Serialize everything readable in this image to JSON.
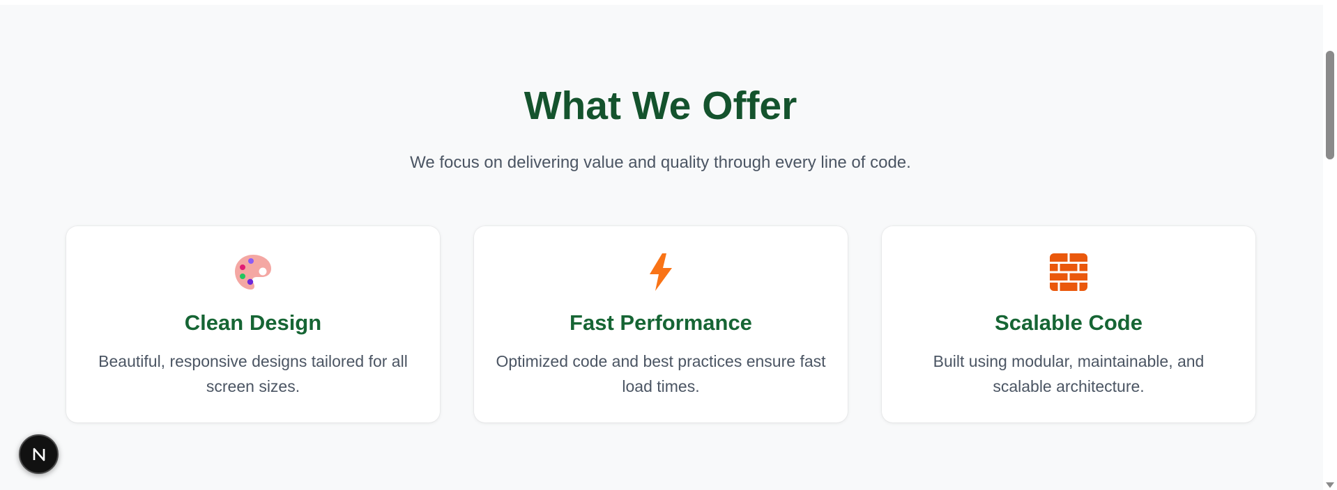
{
  "section": {
    "title": "What We Offer",
    "subtitle": "We focus on delivering value and quality through every line of code."
  },
  "cards": [
    {
      "icon": "palette-icon",
      "title": "Clean Design",
      "description": "Beautiful, responsive designs tailored for all screen sizes."
    },
    {
      "icon": "lightning-icon",
      "title": "Fast Performance",
      "description": "Optimized code and best practices ensure fast load times."
    },
    {
      "icon": "brick-wall-icon",
      "title": "Scalable Code",
      "description": "Built using modular, maintainable, and scalable architecture."
    }
  ],
  "colors": {
    "title": "#14532d",
    "card_title": "#166534",
    "text": "#4b5563",
    "background": "#f8f9fa",
    "lightning": "#f97316",
    "bricks": "#ea580c"
  },
  "nextjs_badge": {
    "letter": "N"
  }
}
